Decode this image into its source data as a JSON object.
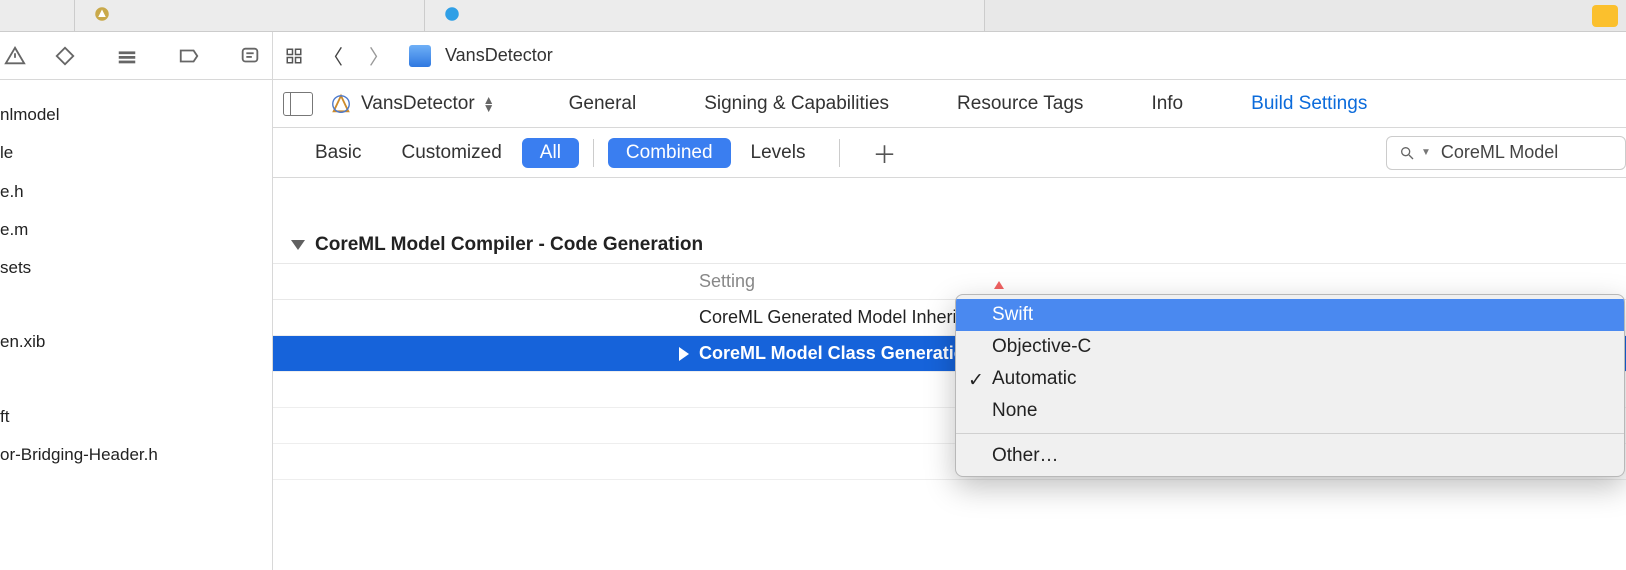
{
  "breadcrumb": {
    "project": "VansDetector"
  },
  "target": {
    "name": "VansDetector"
  },
  "tabs": {
    "general": "General",
    "signing": "Signing & Capabilities",
    "resource": "Resource Tags",
    "info": "Info",
    "build_settings": "Build Settings"
  },
  "filters": {
    "basic": "Basic",
    "customized": "Customized",
    "all": "All",
    "combined": "Combined",
    "levels": "Levels"
  },
  "search": {
    "value": "CoreML Model"
  },
  "sidebar_files": {
    "f0": "nlmodel",
    "f1": "le",
    "f2": "e.h",
    "f3": "e.m",
    "f4": "sets",
    "f5": "en.xib",
    "f6": "ft",
    "f7": "or-Bridging-Header.h"
  },
  "section": {
    "title": "CoreML Model Compiler - Code Generation",
    "col_setting": "Setting",
    "row_inherits": "CoreML Generated Model Inherits NSObject",
    "row_language": "CoreML Model Class Generation Language"
  },
  "popup": {
    "swift": "Swift",
    "objc": "Objective-C",
    "automatic": "Automatic",
    "none": "None",
    "other": "Other…"
  }
}
